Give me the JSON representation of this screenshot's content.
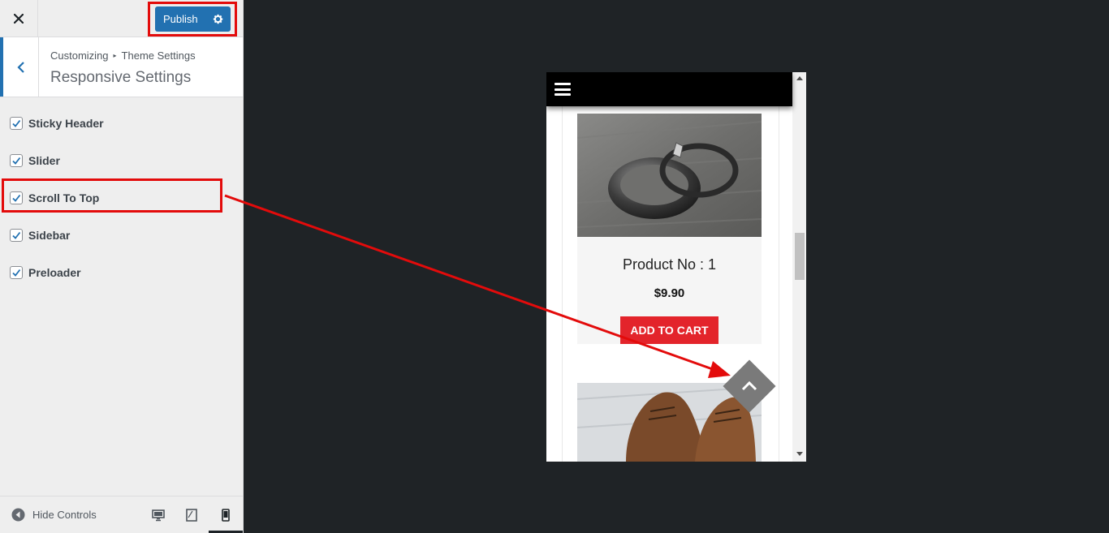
{
  "header": {
    "publish_label": "Publish",
    "close_icon": "close-icon",
    "gear_icon": "gear-icon"
  },
  "section": {
    "breadcrumb_root": "Customizing",
    "breadcrumb_parent": "Theme Settings",
    "title": "Responsive Settings"
  },
  "options": [
    {
      "label": "Sticky Header",
      "checked": true
    },
    {
      "label": "Slider",
      "checked": true
    },
    {
      "label": "Scroll To Top",
      "checked": true
    },
    {
      "label": "Sidebar",
      "checked": true
    },
    {
      "label": "Preloader",
      "checked": true
    }
  ],
  "footer": {
    "hide_controls_label": "Hide Controls",
    "devices": [
      "desktop-icon",
      "tablet-icon",
      "mobile-icon"
    ],
    "active_device": "mobile"
  },
  "preview": {
    "products": [
      {
        "name": "Product No : 1",
        "price": "$9.90",
        "button": "ADD TO CART"
      }
    ]
  },
  "colors": {
    "accent": "#2271b1",
    "highlight": "#e30b0b",
    "cart_button": "#e3242b",
    "preview_bg": "#1f2326"
  }
}
